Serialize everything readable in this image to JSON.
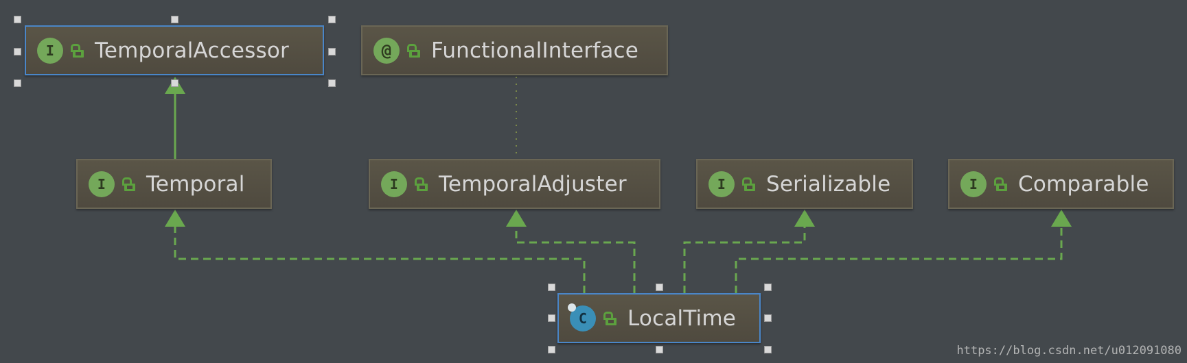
{
  "diagram": {
    "nodes": [
      {
        "id": "temporal-accessor",
        "kind": "interface",
        "badge": "I",
        "label": "TemporalAccessor",
        "selected": true
      },
      {
        "id": "functional-interface",
        "kind": "annotation",
        "badge": "@",
        "label": "FunctionalInterface"
      },
      {
        "id": "temporal",
        "kind": "interface",
        "badge": "I",
        "label": "Temporal"
      },
      {
        "id": "temporal-adjuster",
        "kind": "interface",
        "badge": "I",
        "label": "TemporalAdjuster"
      },
      {
        "id": "serializable",
        "kind": "interface",
        "badge": "I",
        "label": "Serializable"
      },
      {
        "id": "comparable",
        "kind": "interface",
        "badge": "I",
        "label": "Comparable"
      },
      {
        "id": "local-time",
        "kind": "class",
        "badge": "C",
        "label": "LocalTime",
        "selected": true
      }
    ],
    "edges": [
      {
        "from": "temporal",
        "to": "temporal-accessor",
        "type": "extends"
      },
      {
        "from": "temporal-adjuster",
        "to": "functional-interface",
        "type": "annotated"
      },
      {
        "from": "local-time",
        "to": "temporal",
        "type": "implements"
      },
      {
        "from": "local-time",
        "to": "temporal-adjuster",
        "type": "implements"
      },
      {
        "from": "local-time",
        "to": "serializable",
        "type": "implements"
      },
      {
        "from": "local-time",
        "to": "comparable",
        "type": "implements"
      }
    ],
    "colors": {
      "background": "#43484c",
      "node_fill": "#544f43",
      "edge_green": "#6aa84f",
      "annotation_edge": "#7c8a4a",
      "selection": "#4a86c8"
    }
  },
  "watermark": "https://blog.csdn.net/u012091080"
}
